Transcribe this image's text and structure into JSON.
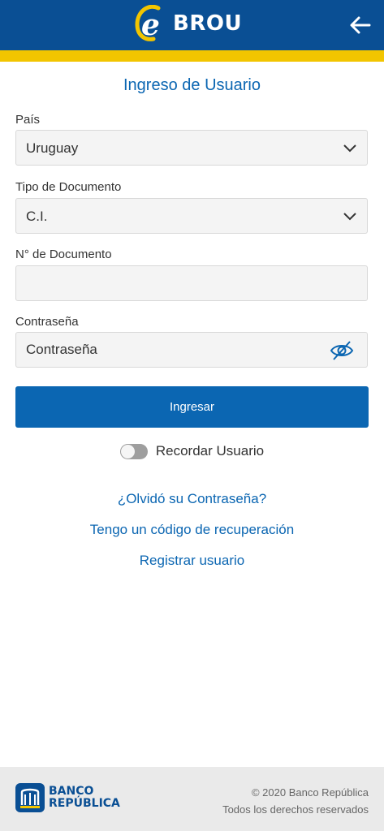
{
  "header": {
    "brand_text": "BROU",
    "colors": {
      "bar": "#0a4f94",
      "stripe": "#f2c500",
      "accent": "#0b66b2"
    },
    "icons": {
      "logo": "e-logo-icon",
      "back": "arrow-left-icon"
    }
  },
  "page": {
    "title": "Ingreso de Usuario"
  },
  "form": {
    "country": {
      "label": "País",
      "value": "Uruguay",
      "icon": "chevron-down-icon"
    },
    "doc_type": {
      "label": "Tipo de Documento",
      "value": "C.I.",
      "icon": "chevron-down-icon"
    },
    "doc_number": {
      "label": "N° de Documento",
      "value": ""
    },
    "password": {
      "label": "Contraseña",
      "placeholder": "Contraseña",
      "icon": "eye-slash-icon"
    },
    "submit_label": "Ingresar",
    "remember": {
      "label": "Recordar Usuario",
      "checked": false
    }
  },
  "links": {
    "forgot": "¿Olvidó su Contraseña?",
    "recovery": "Tengo un código de recuperación",
    "register": "Registrar usuario"
  },
  "footer": {
    "logo_line1": "BANCO",
    "logo_line2": "REPÚBLICA",
    "copyright": "© 2020 Banco República",
    "rights": "Todos los derechos reservados"
  }
}
